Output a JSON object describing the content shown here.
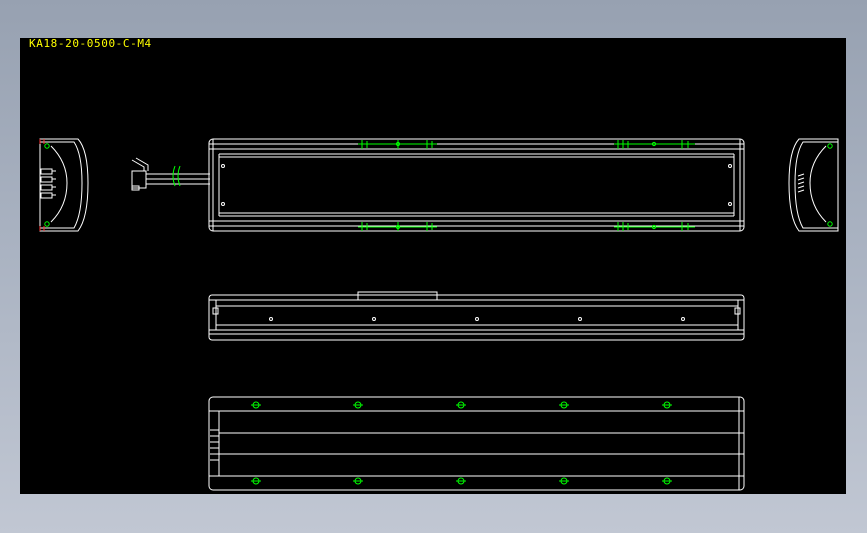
{
  "drawing": {
    "title": "KA18-20-0500-C-M4",
    "title_color": "#ffff00"
  },
  "colors": {
    "background_outer": "#a9b2c1",
    "viewport": "#000000",
    "outline": "#ffffff",
    "dimension": "#00ff00",
    "cut_marks": "#ff3333"
  },
  "views": [
    {
      "name": "left-end-view"
    },
    {
      "name": "top-view"
    },
    {
      "name": "right-end-view"
    },
    {
      "name": "front-view"
    },
    {
      "name": "bottom-view"
    }
  ]
}
